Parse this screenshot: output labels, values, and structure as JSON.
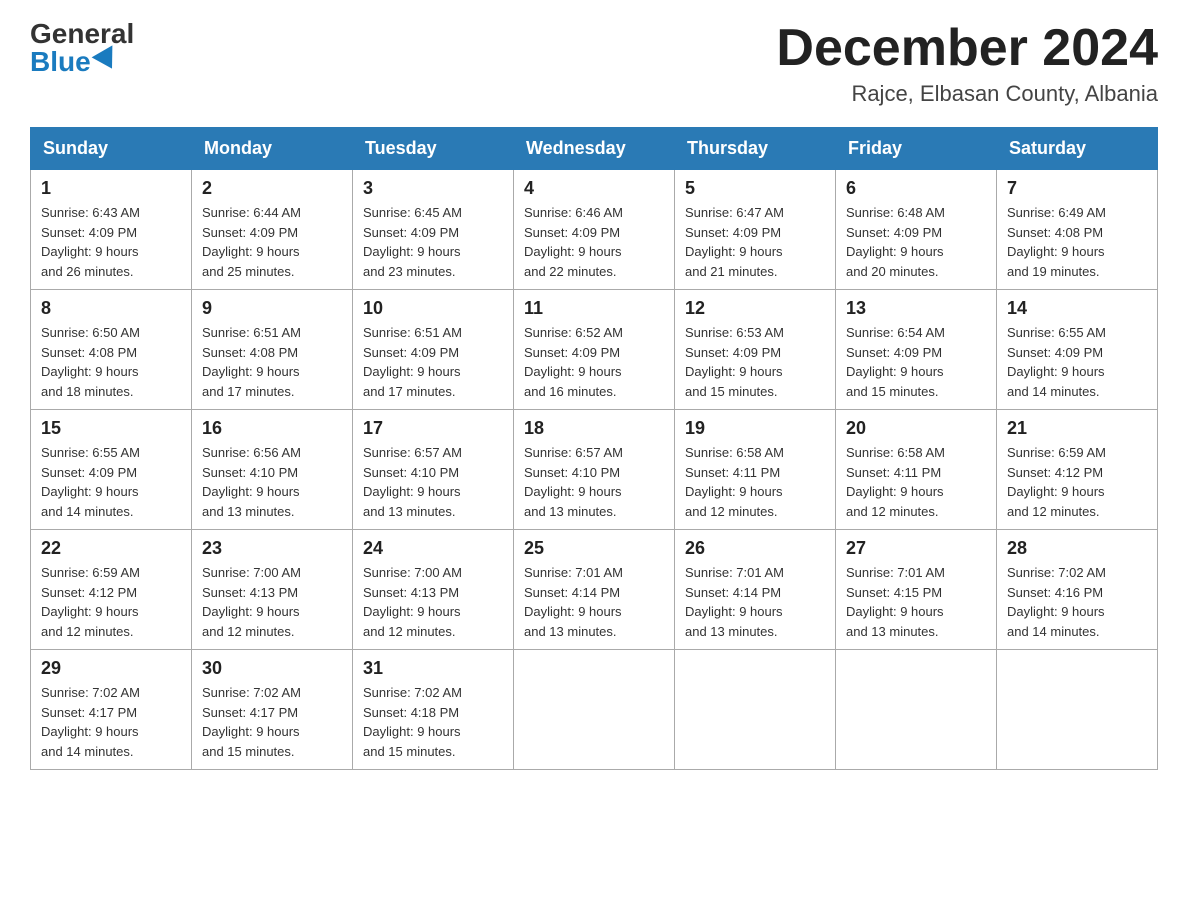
{
  "logo": {
    "general": "General",
    "blue": "Blue"
  },
  "header": {
    "month": "December 2024",
    "location": "Rajce, Elbasan County, Albania"
  },
  "days_of_week": [
    "Sunday",
    "Monday",
    "Tuesday",
    "Wednesday",
    "Thursday",
    "Friday",
    "Saturday"
  ],
  "weeks": [
    [
      {
        "day": "1",
        "sunrise": "6:43 AM",
        "sunset": "4:09 PM",
        "daylight": "9 hours and 26 minutes."
      },
      {
        "day": "2",
        "sunrise": "6:44 AM",
        "sunset": "4:09 PM",
        "daylight": "9 hours and 25 minutes."
      },
      {
        "day": "3",
        "sunrise": "6:45 AM",
        "sunset": "4:09 PM",
        "daylight": "9 hours and 23 minutes."
      },
      {
        "day": "4",
        "sunrise": "6:46 AM",
        "sunset": "4:09 PM",
        "daylight": "9 hours and 22 minutes."
      },
      {
        "day": "5",
        "sunrise": "6:47 AM",
        "sunset": "4:09 PM",
        "daylight": "9 hours and 21 minutes."
      },
      {
        "day": "6",
        "sunrise": "6:48 AM",
        "sunset": "4:09 PM",
        "daylight": "9 hours and 20 minutes."
      },
      {
        "day": "7",
        "sunrise": "6:49 AM",
        "sunset": "4:08 PM",
        "daylight": "9 hours and 19 minutes."
      }
    ],
    [
      {
        "day": "8",
        "sunrise": "6:50 AM",
        "sunset": "4:08 PM",
        "daylight": "9 hours and 18 minutes."
      },
      {
        "day": "9",
        "sunrise": "6:51 AM",
        "sunset": "4:08 PM",
        "daylight": "9 hours and 17 minutes."
      },
      {
        "day": "10",
        "sunrise": "6:51 AM",
        "sunset": "4:09 PM",
        "daylight": "9 hours and 17 minutes."
      },
      {
        "day": "11",
        "sunrise": "6:52 AM",
        "sunset": "4:09 PM",
        "daylight": "9 hours and 16 minutes."
      },
      {
        "day": "12",
        "sunrise": "6:53 AM",
        "sunset": "4:09 PM",
        "daylight": "9 hours and 15 minutes."
      },
      {
        "day": "13",
        "sunrise": "6:54 AM",
        "sunset": "4:09 PM",
        "daylight": "9 hours and 15 minutes."
      },
      {
        "day": "14",
        "sunrise": "6:55 AM",
        "sunset": "4:09 PM",
        "daylight": "9 hours and 14 minutes."
      }
    ],
    [
      {
        "day": "15",
        "sunrise": "6:55 AM",
        "sunset": "4:09 PM",
        "daylight": "9 hours and 14 minutes."
      },
      {
        "day": "16",
        "sunrise": "6:56 AM",
        "sunset": "4:10 PM",
        "daylight": "9 hours and 13 minutes."
      },
      {
        "day": "17",
        "sunrise": "6:57 AM",
        "sunset": "4:10 PM",
        "daylight": "9 hours and 13 minutes."
      },
      {
        "day": "18",
        "sunrise": "6:57 AM",
        "sunset": "4:10 PM",
        "daylight": "9 hours and 13 minutes."
      },
      {
        "day": "19",
        "sunrise": "6:58 AM",
        "sunset": "4:11 PM",
        "daylight": "9 hours and 12 minutes."
      },
      {
        "day": "20",
        "sunrise": "6:58 AM",
        "sunset": "4:11 PM",
        "daylight": "9 hours and 12 minutes."
      },
      {
        "day": "21",
        "sunrise": "6:59 AM",
        "sunset": "4:12 PM",
        "daylight": "9 hours and 12 minutes."
      }
    ],
    [
      {
        "day": "22",
        "sunrise": "6:59 AM",
        "sunset": "4:12 PM",
        "daylight": "9 hours and 12 minutes."
      },
      {
        "day": "23",
        "sunrise": "7:00 AM",
        "sunset": "4:13 PM",
        "daylight": "9 hours and 12 minutes."
      },
      {
        "day": "24",
        "sunrise": "7:00 AM",
        "sunset": "4:13 PM",
        "daylight": "9 hours and 12 minutes."
      },
      {
        "day": "25",
        "sunrise": "7:01 AM",
        "sunset": "4:14 PM",
        "daylight": "9 hours and 13 minutes."
      },
      {
        "day": "26",
        "sunrise": "7:01 AM",
        "sunset": "4:14 PM",
        "daylight": "9 hours and 13 minutes."
      },
      {
        "day": "27",
        "sunrise": "7:01 AM",
        "sunset": "4:15 PM",
        "daylight": "9 hours and 13 minutes."
      },
      {
        "day": "28",
        "sunrise": "7:02 AM",
        "sunset": "4:16 PM",
        "daylight": "9 hours and 14 minutes."
      }
    ],
    [
      {
        "day": "29",
        "sunrise": "7:02 AM",
        "sunset": "4:17 PM",
        "daylight": "9 hours and 14 minutes."
      },
      {
        "day": "30",
        "sunrise": "7:02 AM",
        "sunset": "4:17 PM",
        "daylight": "9 hours and 15 minutes."
      },
      {
        "day": "31",
        "sunrise": "7:02 AM",
        "sunset": "4:18 PM",
        "daylight": "9 hours and 15 minutes."
      },
      null,
      null,
      null,
      null
    ]
  ],
  "labels": {
    "sunrise": "Sunrise:",
    "sunset": "Sunset:",
    "daylight": "Daylight:"
  }
}
